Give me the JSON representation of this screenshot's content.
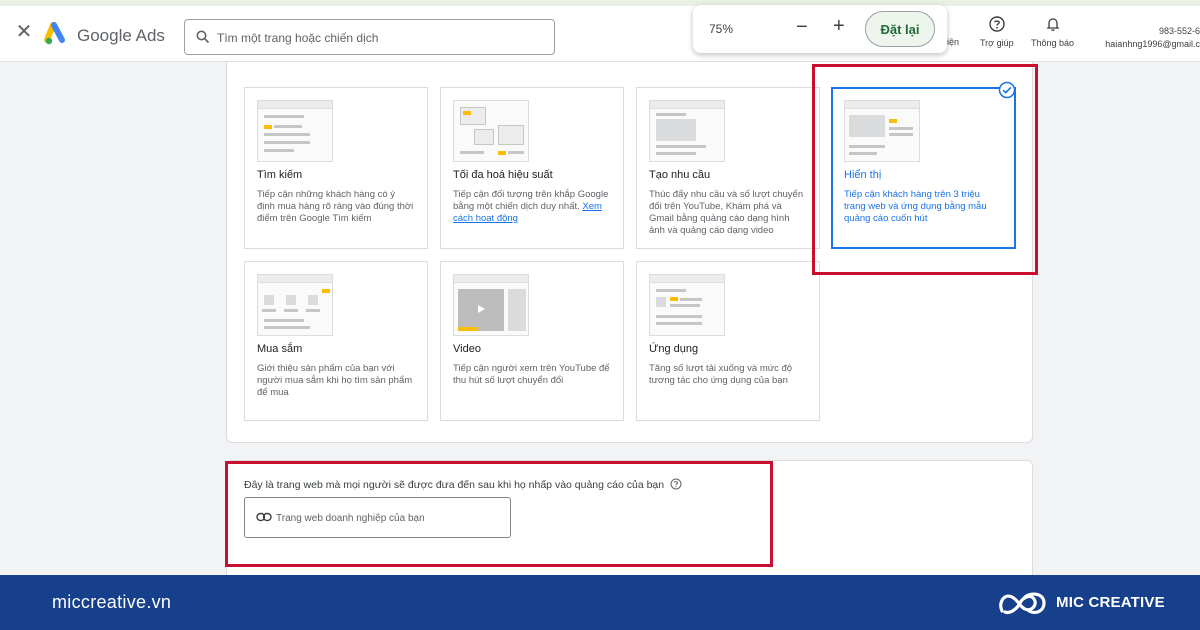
{
  "header": {
    "brand": "Google Ads",
    "search_placeholder": "Tìm một trang hoặc chiến dịch",
    "zoom": {
      "level": "75%",
      "minus": "−",
      "plus": "+",
      "reset": "Đặt lại"
    },
    "partial_label": "iện",
    "help_label": "Trợ giúp",
    "notifications_label": "Thông báo",
    "account_id": "983-552-6",
    "account_email": "haianhng1996@gmail.c"
  },
  "campaign_types": [
    {
      "title": "Tìm kiếm",
      "desc": "Tiếp cận những khách hàng có ý định mua hàng rõ ràng vào đúng thời điểm trên Google Tìm kiếm",
      "selected": false
    },
    {
      "title": "Tối đa hoá hiệu suất",
      "desc": "Tiếp cận đối tượng trên khắp Google bằng một chiến dịch duy nhất.",
      "link": "Xem cách hoạt động",
      "selected": false
    },
    {
      "title": "Tạo nhu cầu",
      "desc": "Thúc đẩy nhu cầu và số lượt chuyển đổi trên YouTube, Khám phá và Gmail bằng quảng cáo dạng hình ảnh và quảng cáo dạng video",
      "selected": false
    },
    {
      "title": "Hiển thị",
      "desc": "Tiếp cận khách hàng trên 3 triệu trang web và ứng dụng bằng mẫu quảng cáo cuốn hút",
      "selected": true
    },
    {
      "title": "Mua sắm",
      "desc": "Giới thiệu sản phẩm của bạn với người mua sắm khi họ tìm sản phẩm để mua",
      "selected": false
    },
    {
      "title": "Video",
      "desc": "Tiếp cận người xem trên YouTube để thu hút số lượt chuyển đổi",
      "selected": false
    },
    {
      "title": "Ứng dụng",
      "desc": "Tăng số lượt tải xuống và mức độ tương tác cho ứng dụng của bạn",
      "selected": false
    }
  ],
  "website": {
    "label": "Đây là trang web mà mọi người sẽ được đưa đến sau khi họ nhấp vào quảng cáo của bạn",
    "placeholder": "Trang web doanh nghiệp của bạn"
  },
  "footer": {
    "site": "miccreative.vn",
    "brand": "MIC CREATIVE"
  },
  "colors": {
    "accent": "#1a73e8",
    "highlight": "#c8102e",
    "footer_bg": "#163f8c"
  }
}
